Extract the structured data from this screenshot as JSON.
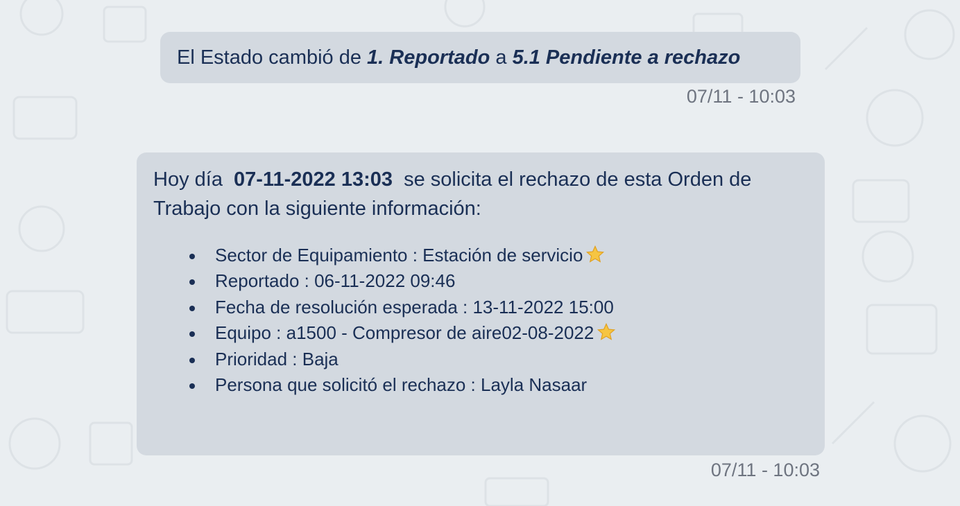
{
  "messages": {
    "status_change": {
      "prefix": "El Estado cambió de",
      "from_state": "1. Reportado",
      "connector": "a",
      "to_state": "5.1 Pendiente a rechazo",
      "timestamp": "07/11 - 10:03"
    },
    "rejection_request": {
      "intro_before": "Hoy día",
      "date": "07-11-2022 13:03",
      "intro_after": "se solicita el rechazo de esta Orden de Trabajo con la siguiente información:",
      "items": [
        {
          "text": "Sector de Equipamiento : Estación de servicio",
          "starred": true
        },
        {
          "text": "Reportado : 06-11-2022 09:46",
          "starred": false
        },
        {
          "text": "Fecha de resolución esperada : 13-11-2022 15:00",
          "starred": false
        },
        {
          "text": "Equipo : a1500 - Compresor de aire02-08-2022",
          "starred": true
        },
        {
          "text": "Prioridad : Baja",
          "starred": false
        },
        {
          "text": "Persona que solicitó el rechazo : Layla Nasaar",
          "starred": false
        }
      ],
      "timestamp": "07/11 - 10:03"
    }
  },
  "colors": {
    "background": "#eaeef1",
    "bubble": "#d3d9e0",
    "text": "#1a2f55",
    "timestamp": "#6e7480",
    "star": "#f6c542"
  }
}
